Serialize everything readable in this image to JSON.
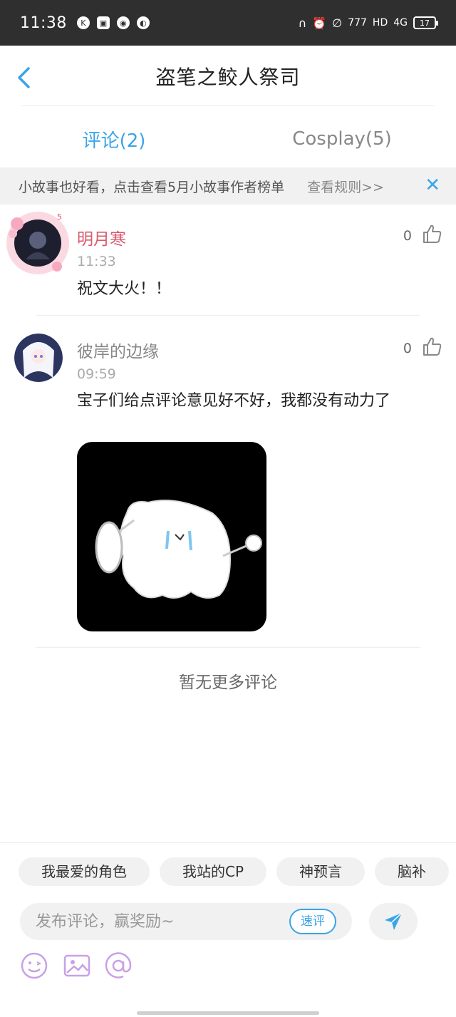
{
  "status_bar": {
    "time": "11:38",
    "battery": "17",
    "network": "4G"
  },
  "header": {
    "title": "盗笔之鲛人祭司"
  },
  "tabs": [
    {
      "label": "评论(2)",
      "active": true
    },
    {
      "label": "Cosplay(5)",
      "active": false
    }
  ],
  "notice": {
    "text": "小故事也好看，点击查看5月小故事作者榜单",
    "rules": "查看规则>>",
    "close": "✕"
  },
  "comments": [
    {
      "username": "明月寒",
      "time": "11:33",
      "text": "祝文大火！！",
      "likes": "0",
      "name_color": "#d85a6e"
    },
    {
      "username": "彼岸的边缘",
      "time": "09:59",
      "text": "宝子们给点评论意见好不好，我都没有动力了",
      "likes": "0",
      "name_color": "#888888"
    }
  ],
  "empty_message": "暂无更多评论",
  "composer": {
    "chips": [
      "我最爱的角色",
      "我站的CP",
      "神预言",
      "脑补"
    ],
    "placeholder": "发布评论，赢奖励~",
    "quick_label": "速评"
  },
  "colors": {
    "accent": "#3aa4e8",
    "tool_icon": "#c9a0e6"
  }
}
